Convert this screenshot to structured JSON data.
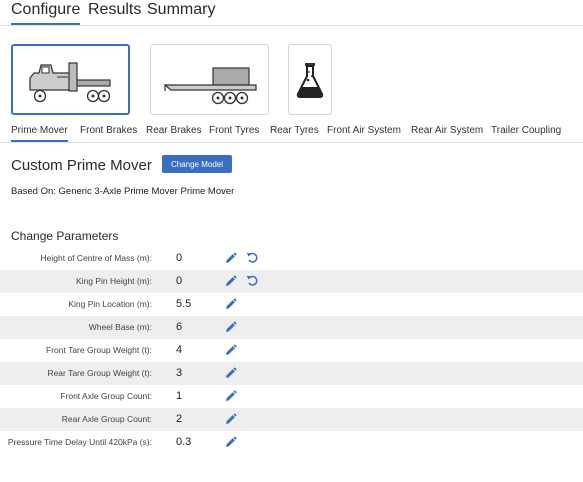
{
  "top_tabs": [
    "Configure",
    "Results",
    "Summary"
  ],
  "active_top_tab": 0,
  "cards": [
    {
      "icon": "prime-mover-truck-icon",
      "selected": true
    },
    {
      "icon": "flatbed-trailer-icon",
      "selected": false
    },
    {
      "icon": "flask-icon",
      "selected": false
    }
  ],
  "components": [
    "Prime Mover",
    "Front Brakes",
    "Rear Brakes",
    "Front Tyres",
    "Rear Tyres",
    "Front Air System",
    "Rear Air System",
    "Trailer Coupling"
  ],
  "active_component": 0,
  "heading": "Custom Prime Mover",
  "change_model_label": "Change Model",
  "based_on": "Based On: Generic 3-Axle Prime Mover Prime Mover",
  "section_title": "Change Parameters",
  "params": [
    {
      "label": "Height of Centre of Mass (m):",
      "value": "0",
      "resettable": true
    },
    {
      "label": "King Pin Height (m):",
      "value": "0",
      "resettable": true
    },
    {
      "label": "King Pin Location (m):",
      "value": "5.5",
      "resettable": false
    },
    {
      "label": "Wheel Base (m):",
      "value": "6",
      "resettable": false
    },
    {
      "label": "Front Tare Group Weight (t):",
      "value": "4",
      "resettable": false
    },
    {
      "label": "Rear Tare Group Weight (t):",
      "value": "3",
      "resettable": false
    },
    {
      "label": "Front Axle Group Count:",
      "value": "1",
      "resettable": false
    },
    {
      "label": "Rear Axle Group Count:",
      "value": "2",
      "resettable": false
    },
    {
      "label": "Pressure Time Delay Until 420kPa (s):",
      "value": "0.3",
      "resettable": false
    }
  ],
  "colors": {
    "accent": "#3a6fbf",
    "row_shade": "#eeeeee",
    "border": "#d4d4d4"
  }
}
